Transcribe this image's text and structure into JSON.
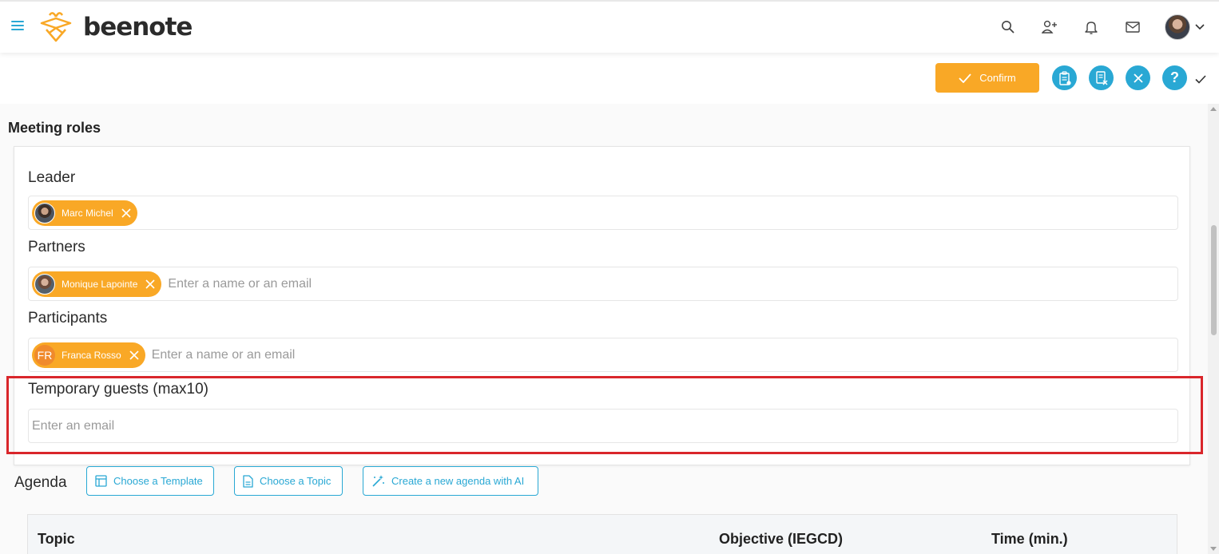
{
  "app": {
    "logo_text": "beenote"
  },
  "header": {
    "icons": [
      "search-icon",
      "add-user-icon",
      "bell-icon",
      "mail-icon",
      "avatar",
      "chevron-down-icon"
    ]
  },
  "actions": {
    "confirm_label": "Confirm",
    "help_label": "?"
  },
  "roles": {
    "section_title": "Meeting roles",
    "leader": {
      "label": "Leader",
      "chips": [
        {
          "name": "Marc Michel"
        }
      ]
    },
    "partners": {
      "label": "Partners",
      "chips": [
        {
          "name": "Monique Lapointe"
        }
      ],
      "placeholder": "Enter a name or an email"
    },
    "participants": {
      "label": "Participants",
      "chips": [
        {
          "name": "Franca Rosso",
          "initials": "FR"
        }
      ],
      "placeholder": "Enter a name or an email"
    },
    "guests": {
      "label": "Temporary guests (max10)",
      "placeholder": "Enter an email"
    }
  },
  "agenda": {
    "title": "Agenda",
    "buttons": {
      "template": "Choose a Template",
      "topic": "Choose a Topic",
      "ai": "Create a new agenda with AI"
    },
    "columns": {
      "topic": "Topic",
      "objective": "Objective (IEGCD)",
      "time": "Time (min.)"
    }
  },
  "colors": {
    "accent": "#29a8d4",
    "chip": "#f9a826",
    "highlight": "#d9262b"
  }
}
